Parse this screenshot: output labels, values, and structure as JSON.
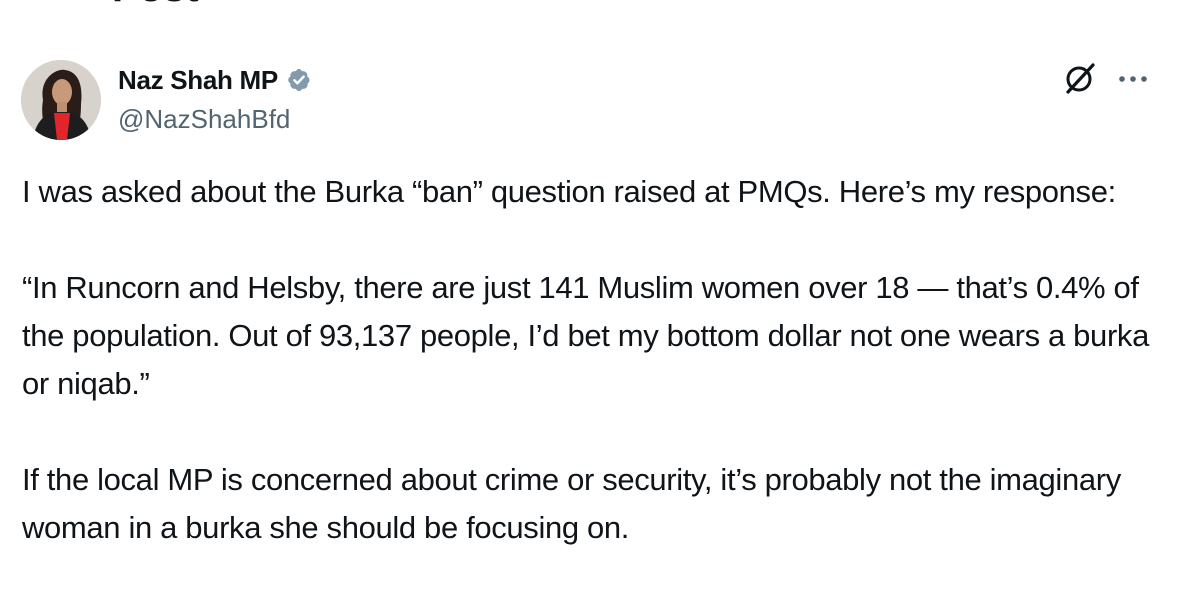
{
  "header": {
    "back_icon": "arrow-left-icon",
    "title": "Post"
  },
  "author": {
    "name": "Naz Shah MP",
    "handle": "@NazShahBfd",
    "verified_icon": "verified-badge-icon",
    "verified_color": "#829aab"
  },
  "actions": {
    "grok_icon": "grok-icon",
    "more_icon": "more-options-icon"
  },
  "tweet": {
    "paragraphs": [
      "I was asked about the Burka “ban” question raised at PMQs. Here’s my response:",
      "“In Runcorn and Helsby, there are just 141 Muslim women over 18 — that’s 0.4% of the population. Out of 93,137 people, I’d bet my bottom dollar not one wears a burka or niqab.”",
      "If the local MP is concerned about crime or security, it’s probably not the imaginary woman in a burka she should be focusing on."
    ]
  },
  "colors": {
    "text_primary": "#0f1419",
    "text_secondary": "#536471",
    "background": "#ffffff"
  }
}
